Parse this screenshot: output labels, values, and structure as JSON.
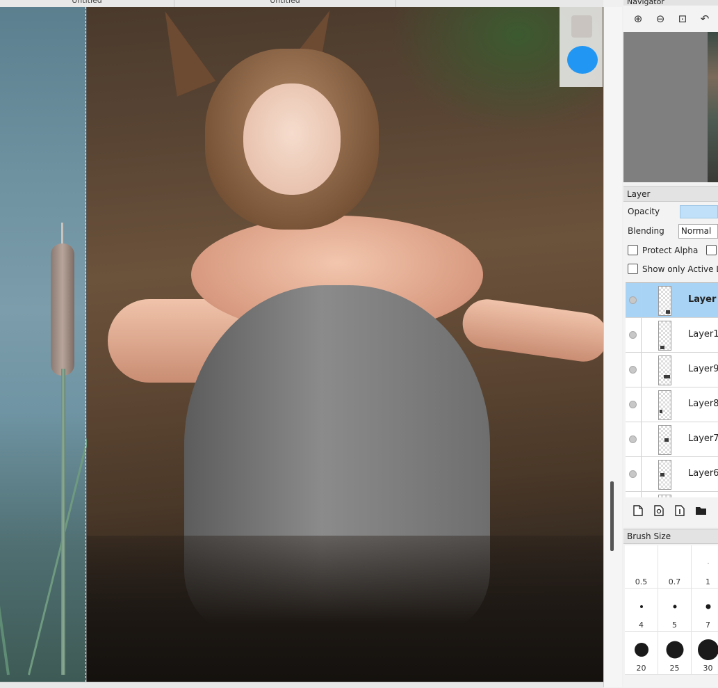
{
  "tabs": [
    {
      "label": "Untitled"
    },
    {
      "label": "Untitled"
    }
  ],
  "navigator": {
    "title": "Navigator",
    "tools": [
      {
        "icon": "zoom-in-icon",
        "glyph": "⊕"
      },
      {
        "icon": "zoom-out-icon",
        "glyph": "⊖"
      },
      {
        "icon": "zoom-fit-icon",
        "glyph": "⊡"
      },
      {
        "icon": "rotate-icon",
        "glyph": "↶"
      }
    ]
  },
  "layer_panel": {
    "title": "Layer",
    "opacity_label": "Opacity",
    "blending_label": "Blending",
    "blending_value": "Normal",
    "protect_alpha_label": "Protect Alpha",
    "show_only_active_label": "Show only Active L",
    "layers": [
      {
        "name": "Layer",
        "active": true
      },
      {
        "name": "Layer1",
        "active": false
      },
      {
        "name": "Layer9",
        "active": false
      },
      {
        "name": "Layer8",
        "active": false
      },
      {
        "name": "Layer7",
        "active": false
      },
      {
        "name": "Layer6",
        "active": false
      }
    ],
    "toolbar_icons": [
      "new-layer-icon",
      "new-8bit-layer-icon",
      "new-1bit-layer-icon",
      "new-folder-icon"
    ]
  },
  "brush_size": {
    "title": "Brush Size",
    "sizes": [
      "0.5",
      "0.7",
      "1",
      "4",
      "5",
      "7",
      "20",
      "25",
      "30"
    ]
  },
  "colors": {
    "selection_blue": "#a8d3f5",
    "float_button_blue": "#2196f3"
  }
}
